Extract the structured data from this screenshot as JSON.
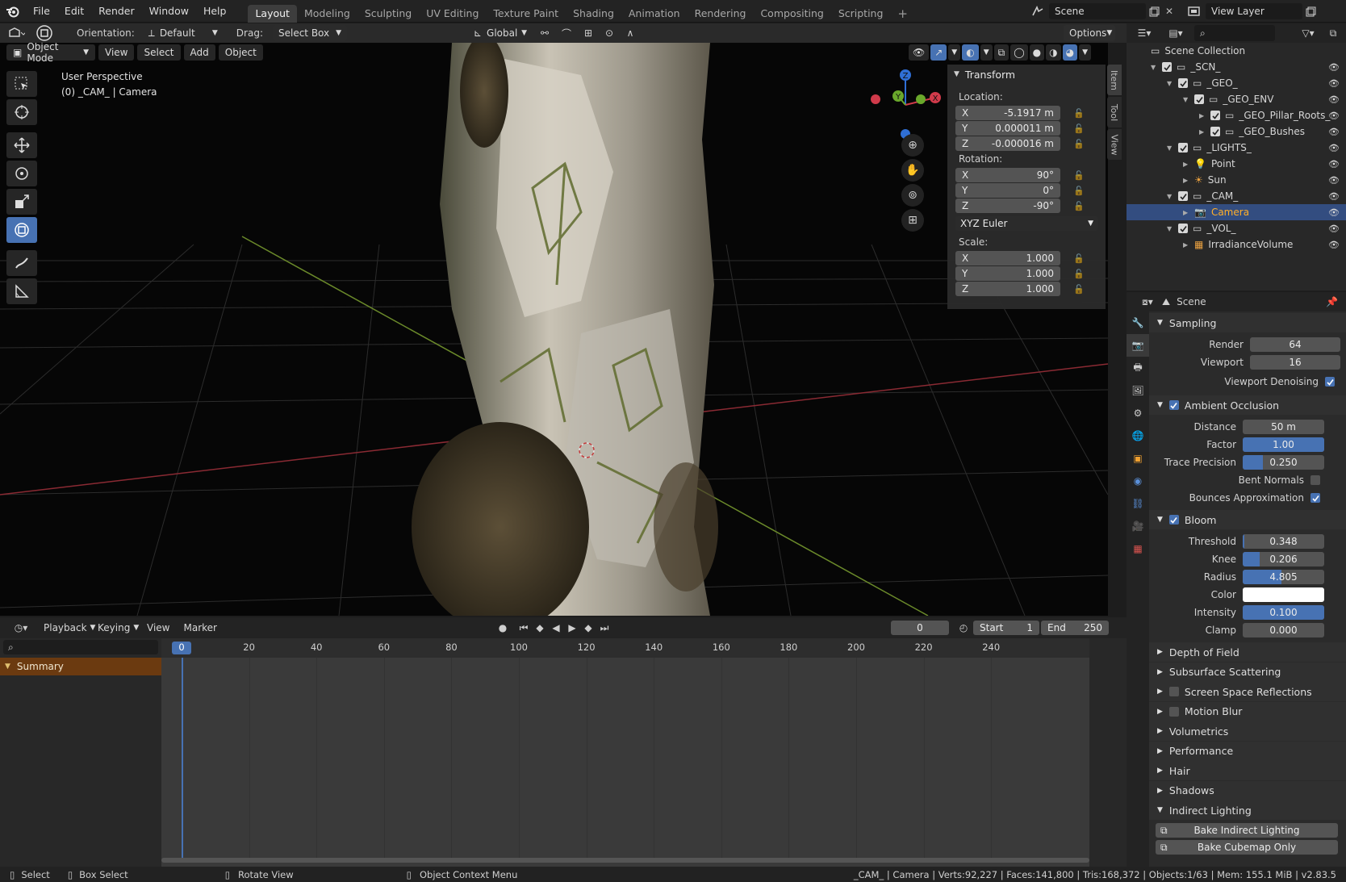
{
  "menu": {
    "items": [
      "File",
      "Edit",
      "Render",
      "Window",
      "Help"
    ]
  },
  "workspaces": {
    "tabs": [
      "Layout",
      "Modeling",
      "Sculpting",
      "UV Editing",
      "Texture Paint",
      "Shading",
      "Animation",
      "Rendering",
      "Compositing",
      "Scripting"
    ],
    "active": "Layout",
    "add_symbol": "+"
  },
  "scene_selector": {
    "value": "Scene"
  },
  "viewlayer_selector": {
    "value": "View Layer"
  },
  "tool_header": {
    "orientation_label": "Orientation:",
    "orientation_value": "Default",
    "drag_label": "Drag:",
    "drag_value": "Select Box",
    "transform_orientation": "Global",
    "options_label": "Options"
  },
  "viewport_header": {
    "mode": "Object Mode",
    "view": "View",
    "select": "Select",
    "add": "Add",
    "object": "Object"
  },
  "viewport": {
    "perspective": "User Perspective",
    "object_info": "(0) _CAM_ | Camera",
    "gizmo_axes": [
      "X",
      "Y",
      "Z"
    ]
  },
  "transform_panel": {
    "title": "Transform",
    "location_label": "Location:",
    "location": [
      {
        "axis": "X",
        "value": "-5.1917 m"
      },
      {
        "axis": "Y",
        "value": "0.000011 m"
      },
      {
        "axis": "Z",
        "value": "-0.000016 m"
      }
    ],
    "rotation_label": "Rotation:",
    "rotation": [
      {
        "axis": "X",
        "value": "90°"
      },
      {
        "axis": "Y",
        "value": "0°"
      },
      {
        "axis": "Z",
        "value": "-90°"
      }
    ],
    "rotation_mode": "XYZ Euler",
    "scale_label": "Scale:",
    "scale": [
      {
        "axis": "X",
        "value": "1.000"
      },
      {
        "axis": "Y",
        "value": "1.000"
      },
      {
        "axis": "Z",
        "value": "1.000"
      }
    ]
  },
  "sidebar_tabs": [
    "Item",
    "Tool",
    "View"
  ],
  "outliner": {
    "root": "Scene Collection",
    "items": [
      {
        "label": "_SCN_"
      },
      {
        "label": "_GEO_"
      },
      {
        "label": "_GEO_ENV"
      },
      {
        "label": "_GEO_Pillar_Roots_"
      },
      {
        "label": "_GEO_Bushes"
      },
      {
        "label": "_LIGHTS_"
      },
      {
        "label": "Point"
      },
      {
        "label": "Sun"
      },
      {
        "label": "_CAM_"
      },
      {
        "label": "Camera"
      },
      {
        "label": "_VOL_"
      },
      {
        "label": "IrradianceVolume"
      }
    ]
  },
  "properties": {
    "context": "Scene",
    "sampling": {
      "title": "Sampling",
      "render_label": "Render",
      "render": "64",
      "viewport_label": "Viewport",
      "viewport": "16",
      "denoise_label": "Viewport Denoising"
    },
    "ao": {
      "title": "Ambient Occlusion",
      "distance_label": "Distance",
      "distance": "50 m",
      "factor_label": "Factor",
      "factor": "1.00",
      "factor_fill": 1.0,
      "trace_label": "Trace Precision",
      "trace": "0.250",
      "trace_fill": 0.25,
      "bent_label": "Bent Normals",
      "bounce_label": "Bounces Approximation"
    },
    "bloom": {
      "title": "Bloom",
      "threshold_label": "Threshold",
      "threshold": "0.348",
      "threshold_fill": 0.0,
      "knee_label": "Knee",
      "knee": "0.206",
      "knee_fill": 0.21,
      "radius_label": "Radius",
      "radius": "4.805",
      "radius_fill": 0.48,
      "color_label": "Color",
      "intensity_label": "Intensity",
      "intensity": "0.100",
      "intensity_fill": 1.0,
      "clamp_label": "Clamp",
      "clamp": "0.000"
    },
    "collapsed": [
      "Depth of Field",
      "Subsurface Scattering",
      "Screen Space Reflections",
      "Motion Blur",
      "Volumetrics",
      "Performance",
      "Hair",
      "Shadows"
    ],
    "indirect": {
      "title": "Indirect Lighting",
      "bake_label": "Bake Indirect Lighting",
      "cubemap_label": "Bake Cubemap Only"
    }
  },
  "timeline": {
    "playback": "Playback",
    "keying": "Keying",
    "view": "View",
    "marker": "Marker",
    "current_frame": "0",
    "start_label": "Start",
    "start": "1",
    "end_label": "End",
    "end": "250",
    "ruler": [
      "0",
      "20",
      "40",
      "60",
      "80",
      "100",
      "120",
      "140",
      "160",
      "180",
      "200",
      "220",
      "240"
    ],
    "summary": "Summary"
  },
  "statusbar": {
    "select": "Select",
    "box_select": "Box Select",
    "rotate_view": "Rotate View",
    "context_menu": "Object Context Menu",
    "stats": "_CAM_ | Camera | Verts:92,227 | Faces:141,800 | Tris:168,372 | Objects:1/63 | Mem: 155.1 MiB | v2.83.5"
  },
  "colors": {
    "accent": "#4772b3",
    "selected_row": "#334d80",
    "camera_label": "#ffaf29",
    "header": "#232323",
    "summary": "#6b3a10"
  }
}
